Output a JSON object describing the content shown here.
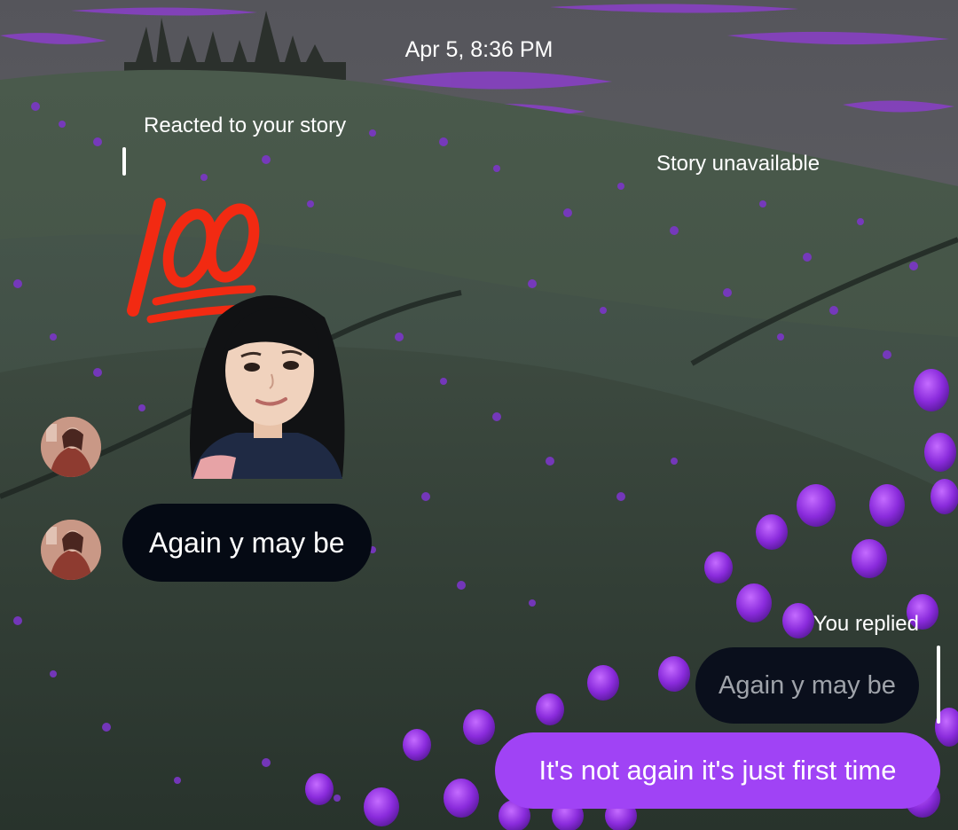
{
  "conversation": {
    "timestamp": "Apr 5, 8:36 PM",
    "reaction_context_label": "Reacted to your story",
    "story_status": "Story unavailable",
    "reaction_emoji": "hundred-points-emoji",
    "reaction_sticker": "avatar-sticker",
    "messages": [
      {
        "direction": "incoming",
        "text": "Again y may be"
      },
      {
        "direction": "outgoing",
        "reply_label": "You replied",
        "quoted_text": "Again y may be",
        "text": "It's not again it's just  first time"
      }
    ]
  },
  "colors": {
    "outgoing_bubble": "#a043f5",
    "incoming_bubble": "#050a14",
    "quoted_bubble": "#0a0f1c",
    "text": "#ffffff",
    "quoted_text": "#9fa3aa"
  }
}
